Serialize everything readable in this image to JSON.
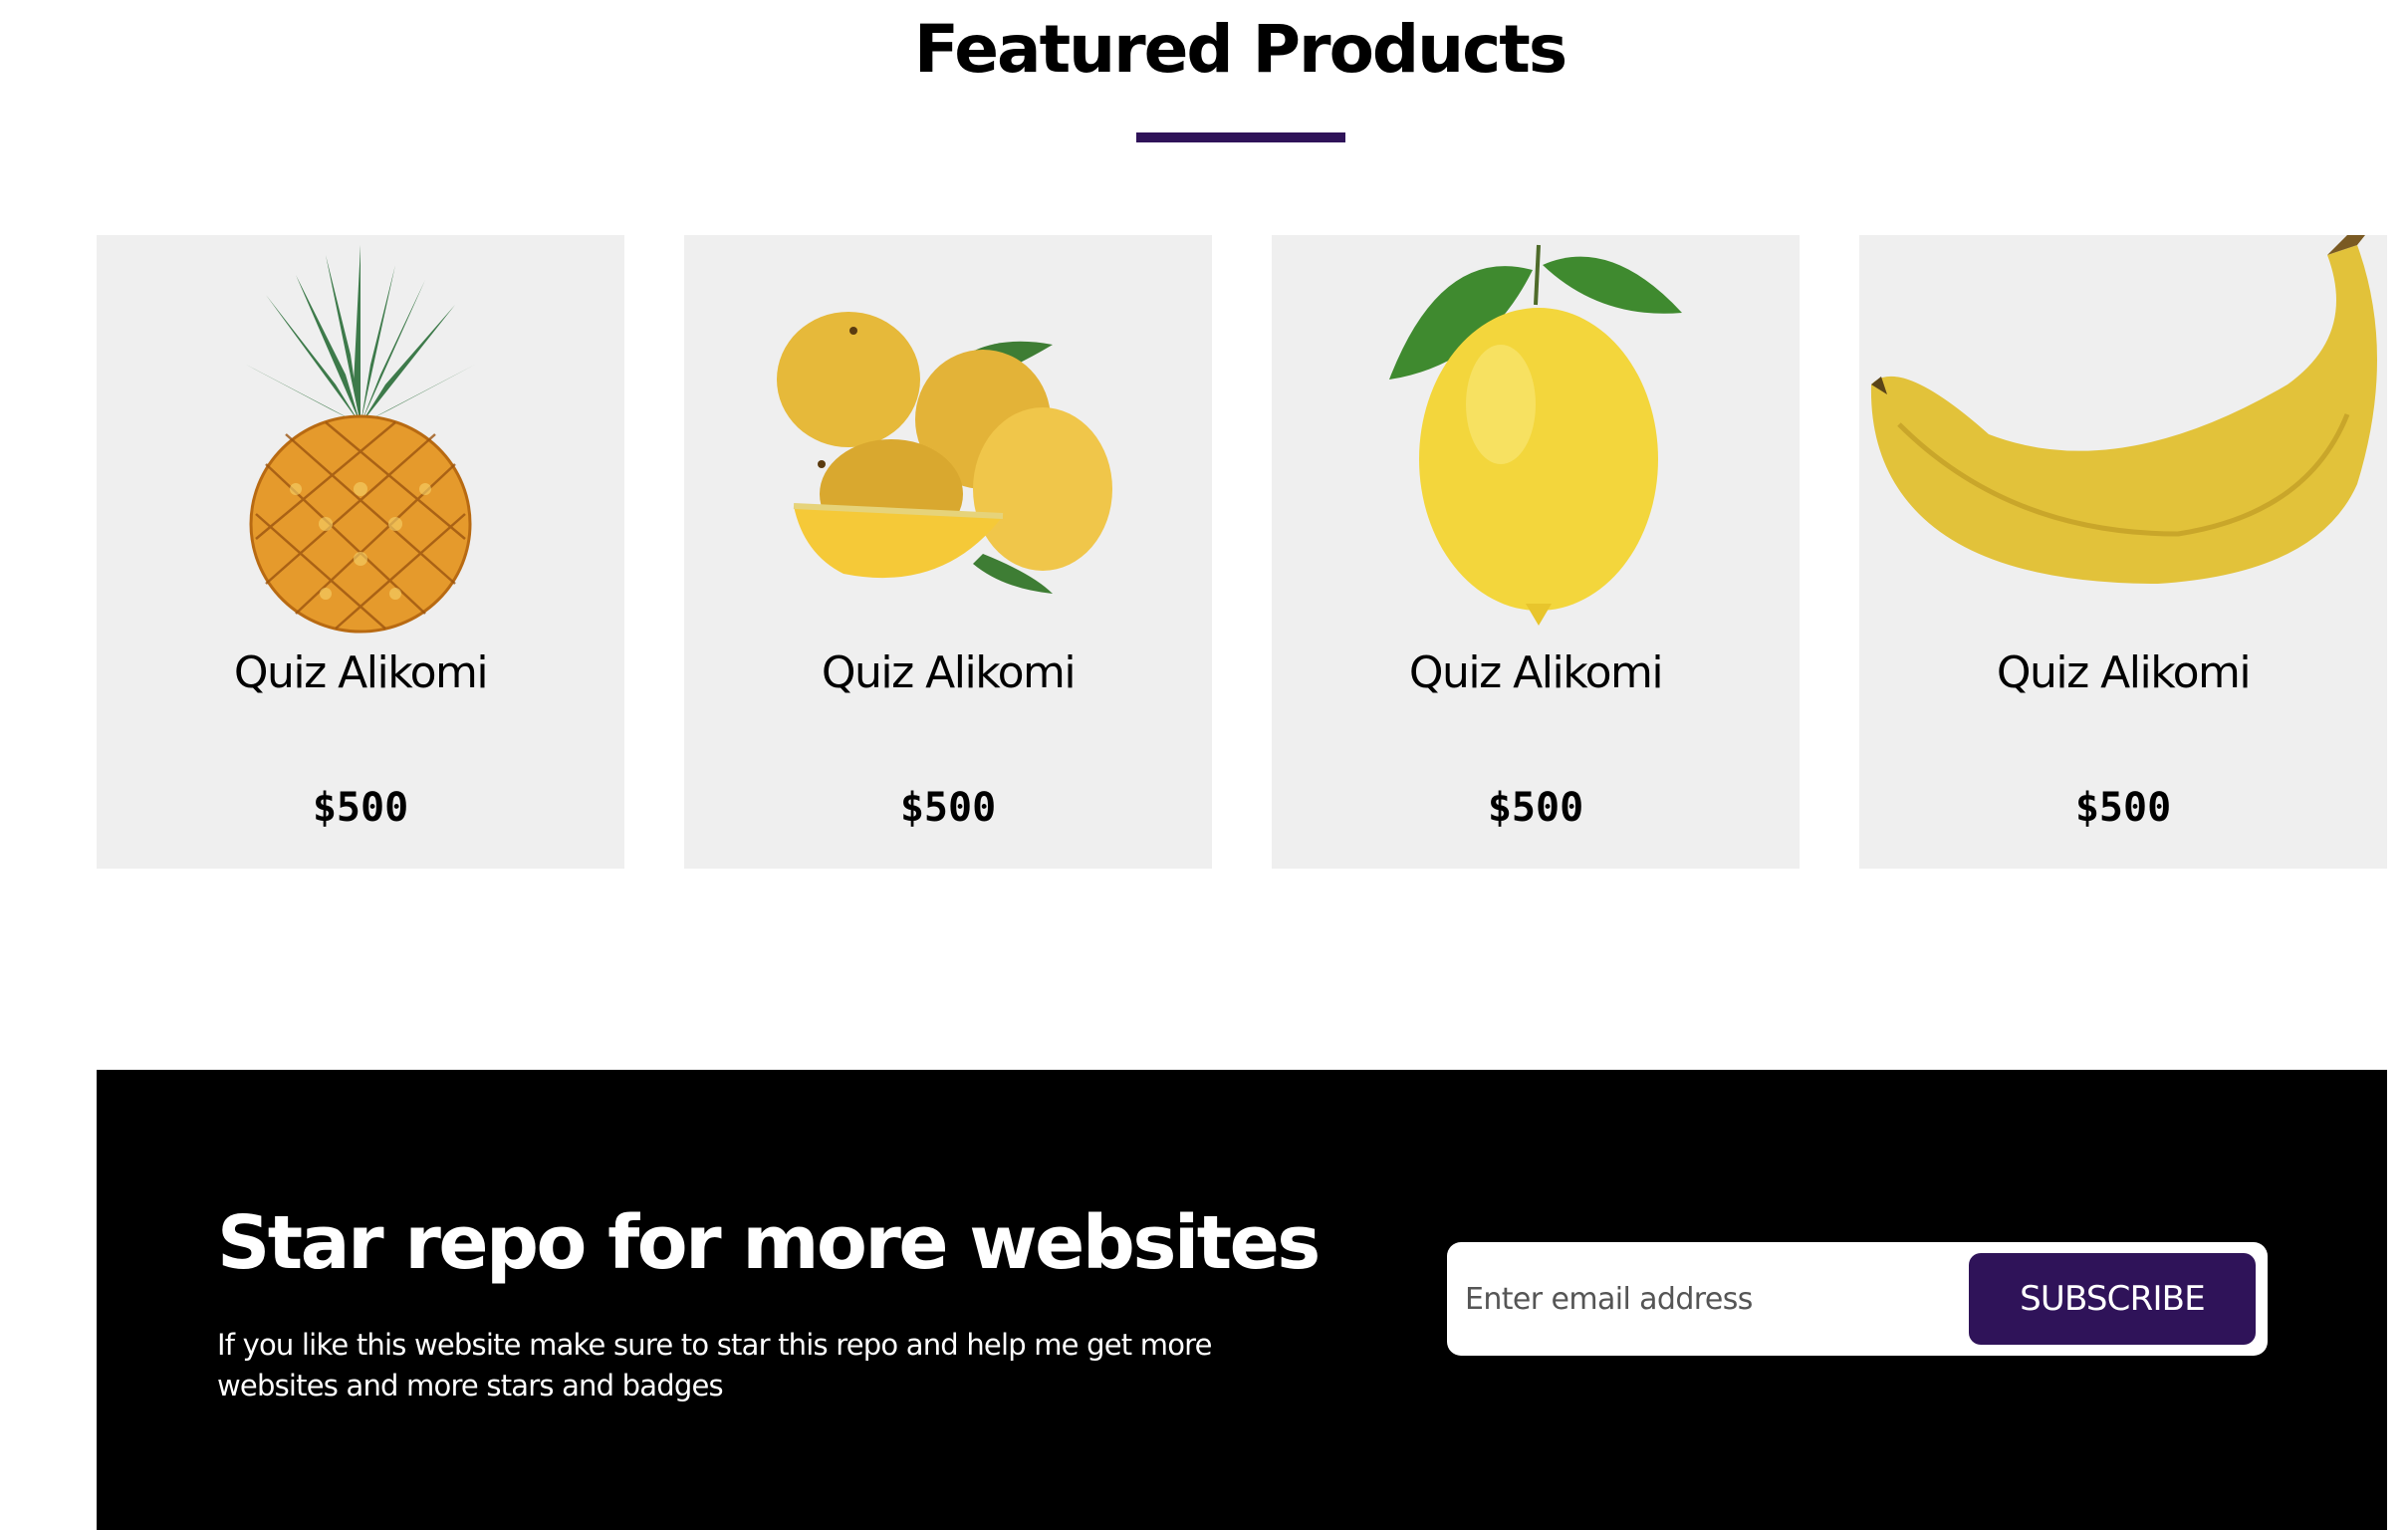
{
  "featured": {
    "title": "Featured Products",
    "accent_color": "#2f1359"
  },
  "products": [
    {
      "icon": "pineapple-image",
      "name": "Quiz Alikomi",
      "price": "$500"
    },
    {
      "icon": "mango-image",
      "name": "Quiz Alikomi",
      "price": "$500"
    },
    {
      "icon": "lemon-image",
      "name": "Quiz Alikomi",
      "price": "$500"
    },
    {
      "icon": "banana-image",
      "name": "Quiz Alikomi",
      "price": "$500"
    }
  ],
  "newsletter": {
    "heading": "Star repo for more websites",
    "text": "If you like this website make sure to star this repo and help me get more websites and more stars and badges",
    "email_placeholder": "Enter email address",
    "button_label": "SUBSCRIBE",
    "background_color": "#000000",
    "button_color": "#2f1359"
  }
}
